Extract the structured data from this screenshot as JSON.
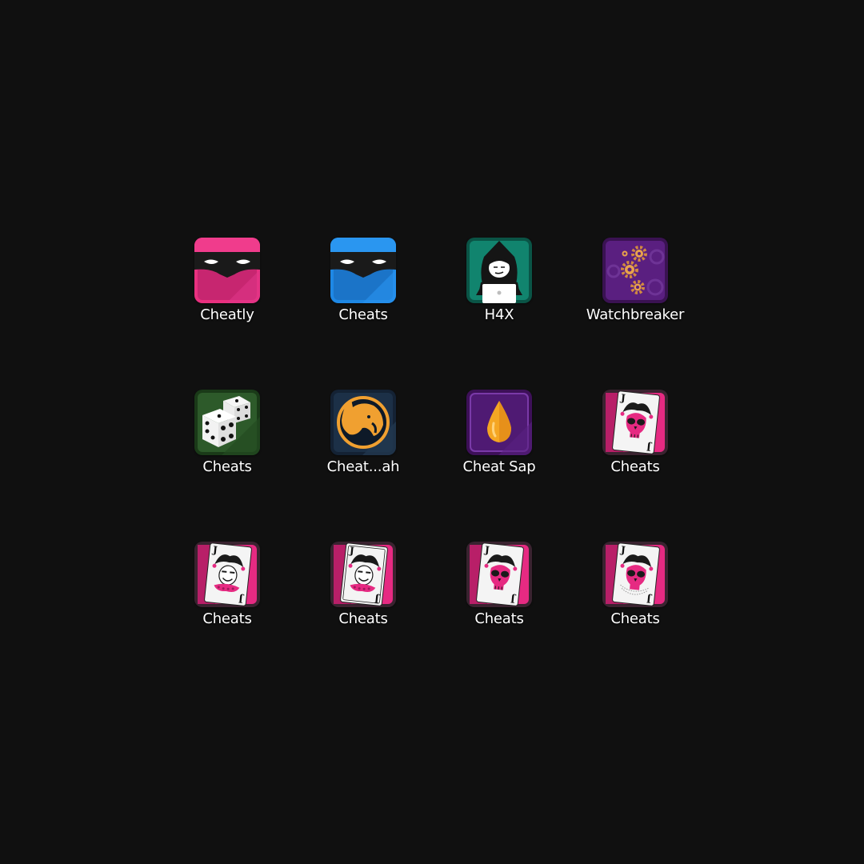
{
  "launcher": {
    "apps": [
      {
        "label": "Cheatly",
        "icon": "pink-bandit-mask-icon"
      },
      {
        "label": "Cheats",
        "icon": "blue-bandit-mask-icon"
      },
      {
        "label": "H4X",
        "icon": "hooded-hacker-icon"
      },
      {
        "label": "Watchbreaker",
        "icon": "gears-icon"
      },
      {
        "label": "Cheats",
        "icon": "dice-icon"
      },
      {
        "label": "Cheat...ah",
        "icon": "cheetah-icon"
      },
      {
        "label": "Cheat Sap",
        "icon": "sap-drop-icon"
      },
      {
        "label": "Cheats",
        "icon": "jester-skull-card-icon"
      },
      {
        "label": "Cheats",
        "icon": "jester-card-icon"
      },
      {
        "label": "Cheats",
        "icon": "jester-card-icon"
      },
      {
        "label": "Cheats",
        "icon": "jester-skull-card-icon"
      },
      {
        "label": "Cheats",
        "icon": "jester-skull-card-icon"
      }
    ]
  },
  "colors": {
    "background": "#101010",
    "pink": "#e8307f",
    "blue": "#1e88e5",
    "teal": "#0f7a66",
    "purple": "#5a1f80",
    "green": "#2d5a2a",
    "navy": "#1c3047",
    "orange": "#f0a030",
    "jester_pink": "#e62a82"
  }
}
